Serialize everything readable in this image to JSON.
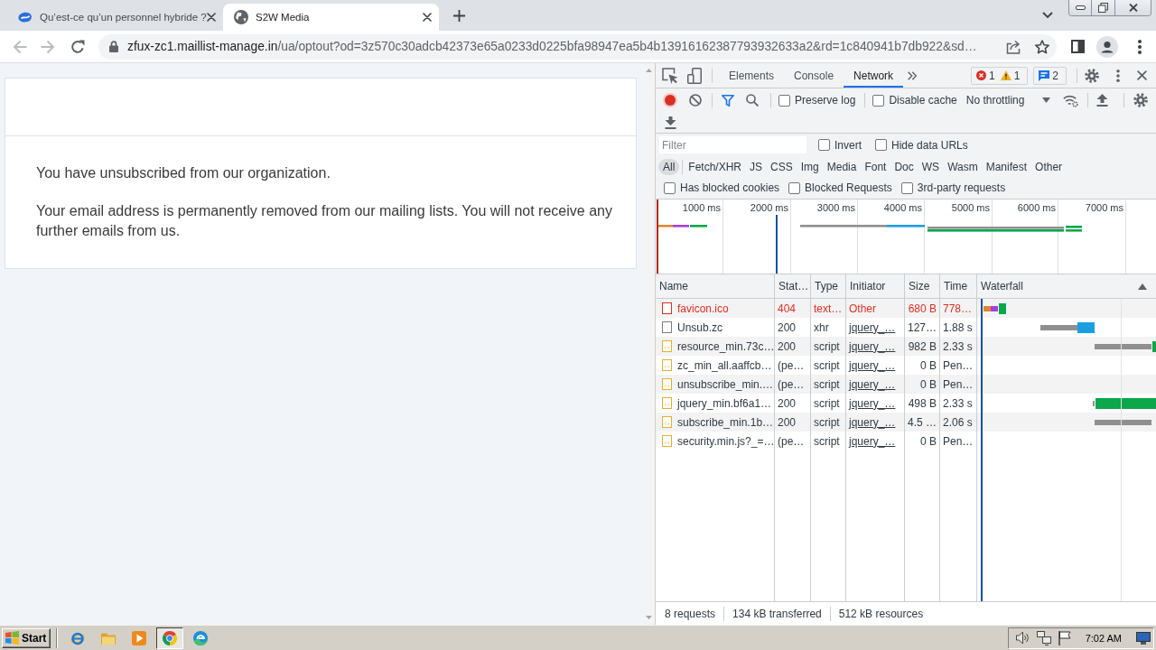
{
  "browser": {
    "tabs": [
      {
        "kind": "logo",
        "title": "Qu’est-ce qu’un personnel hybride ?",
        "selected": false
      },
      {
        "kind": "globe",
        "title": "S2W Media",
        "selected": true
      }
    ],
    "back": {
      "disabled": true
    },
    "forward": {
      "disabled": true
    },
    "address": {
      "host": "zfux-zc1.maillist-manage.in",
      "path": "/ua/optout?od=3z570c30adcb42373e65a0233d0225bfa98947ea5b4b13916162387793932633a2&rd=1c840941b7db922&sd…"
    }
  },
  "page": {
    "message": "You have unsubscribed from our organization.",
    "details": "Your email address is permanently removed from our mailing lists. You will not receive any further emails from us."
  },
  "devtools": {
    "tabs": [
      {
        "label": "Elements",
        "selected": false
      },
      {
        "label": "Console",
        "selected": false
      },
      {
        "label": "Network",
        "selected": true
      }
    ],
    "issues": {
      "errors": "1",
      "warnings": "1",
      "messages": "2"
    },
    "recording": true,
    "filter_active": true,
    "preserve_log": {
      "label": "Preserve log",
      "checked": false
    },
    "disable_cache": {
      "label": "Disable cache",
      "checked": false
    },
    "throttling": "No throttling",
    "filter": {
      "placeholder": "Filter"
    },
    "invert": {
      "label": "Invert",
      "checked": false
    },
    "hide_data_urls": {
      "label": "Hide data URLs",
      "checked": false
    },
    "type_filters": [
      {
        "label": "All",
        "selected": true
      },
      {
        "label": "Fetch/XHR",
        "selected": false
      },
      {
        "label": "JS",
        "selected": false
      },
      {
        "label": "CSS",
        "selected": false
      },
      {
        "label": "Img",
        "selected": false
      },
      {
        "label": "Media",
        "selected": false
      },
      {
        "label": "Font",
        "selected": false
      },
      {
        "label": "Doc",
        "selected": false
      },
      {
        "label": "WS",
        "selected": false
      },
      {
        "label": "Wasm",
        "selected": false
      },
      {
        "label": "Manifest",
        "selected": false
      },
      {
        "label": "Other",
        "selected": false
      }
    ],
    "options": [
      {
        "label": "Has blocked cookies",
        "checked": false
      },
      {
        "label": "Blocked Requests",
        "checked": false
      },
      {
        "label": "3rd-party requests",
        "checked": false
      }
    ],
    "overview": {
      "ticks": [
        "1000 ms",
        "2000 ms",
        "3000 ms",
        "4000 ms",
        "5000 ms",
        "6000 ms",
        "7000 ms"
      ]
    },
    "table": {
      "columns": [
        {
          "label": "Name",
          "sorted": false
        },
        {
          "label": "Stat…",
          "sorted": false
        },
        {
          "label": "Type",
          "sorted": false
        },
        {
          "label": "Initiator",
          "sorted": false
        },
        {
          "label": "Size",
          "sorted": false
        },
        {
          "label": "Time",
          "sorted": false
        },
        {
          "label": "Waterfall",
          "sorted": true
        }
      ],
      "rows": [
        {
          "kind": "document",
          "name": "favicon.ico",
          "status": "404",
          "type": "text…",
          "initiator": "Other",
          "initiator_link": false,
          "size": "680 B",
          "time": "778…",
          "error": true,
          "selected": false
        },
        {
          "kind": "document",
          "name": "Unsub.zc",
          "status": "200",
          "type": "xhr",
          "initiator": "jquery_…",
          "initiator_link": true,
          "size": "127…",
          "time": "1.88 s",
          "error": false,
          "selected": false
        },
        {
          "kind": "script",
          "name": "resource_min.73c…",
          "status": "200",
          "type": "script",
          "initiator": "jquery_…",
          "initiator_link": true,
          "size": "982 B",
          "time": "2.33 s",
          "error": false,
          "selected": false
        },
        {
          "kind": "script",
          "name": "zc_min_all.aaffcb…",
          "status": "(pe…",
          "type": "script",
          "initiator": "jquery_…",
          "initiator_link": true,
          "size": "0 B",
          "time": "Pen…",
          "error": false,
          "selected": false
        },
        {
          "kind": "script",
          "name": "unsubscribe_min.…",
          "status": "(pe…",
          "type": "script",
          "initiator": "jquery_…",
          "initiator_link": true,
          "size": "0 B",
          "time": "Pen…",
          "error": false,
          "selected": false
        },
        {
          "kind": "script",
          "name": "jquery_min.bf6a1…",
          "status": "200",
          "type": "script",
          "initiator": "jquery_…",
          "initiator_link": true,
          "size": "498 B",
          "time": "2.33 s",
          "error": false,
          "selected": false
        },
        {
          "kind": "script",
          "name": "subscribe_min.1b…",
          "status": "200",
          "type": "script",
          "initiator": "jquery_…",
          "initiator_link": true,
          "size": "4.5 …",
          "time": "2.06 s",
          "error": false,
          "selected": false
        },
        {
          "kind": "script",
          "name": "security.min.js?_=…",
          "status": "(pe…",
          "type": "script",
          "initiator": "jquery_…",
          "initiator_link": true,
          "size": "0 B",
          "time": "Pen…",
          "error": false,
          "selected": false
        }
      ]
    },
    "summary": [
      "8 requests",
      "134 kB transferred",
      "512 kB resources"
    ]
  },
  "taskbar": {
    "start": "Start",
    "apps": [
      {
        "kind": "letter_e",
        "selected": false
      },
      {
        "kind": "folder",
        "selected": false
      },
      {
        "kind": "play",
        "selected": false
      },
      {
        "kind": "wheel",
        "selected": true
      },
      {
        "kind": "swirl",
        "selected": false
      }
    ],
    "clock": "7:02 AM"
  }
}
